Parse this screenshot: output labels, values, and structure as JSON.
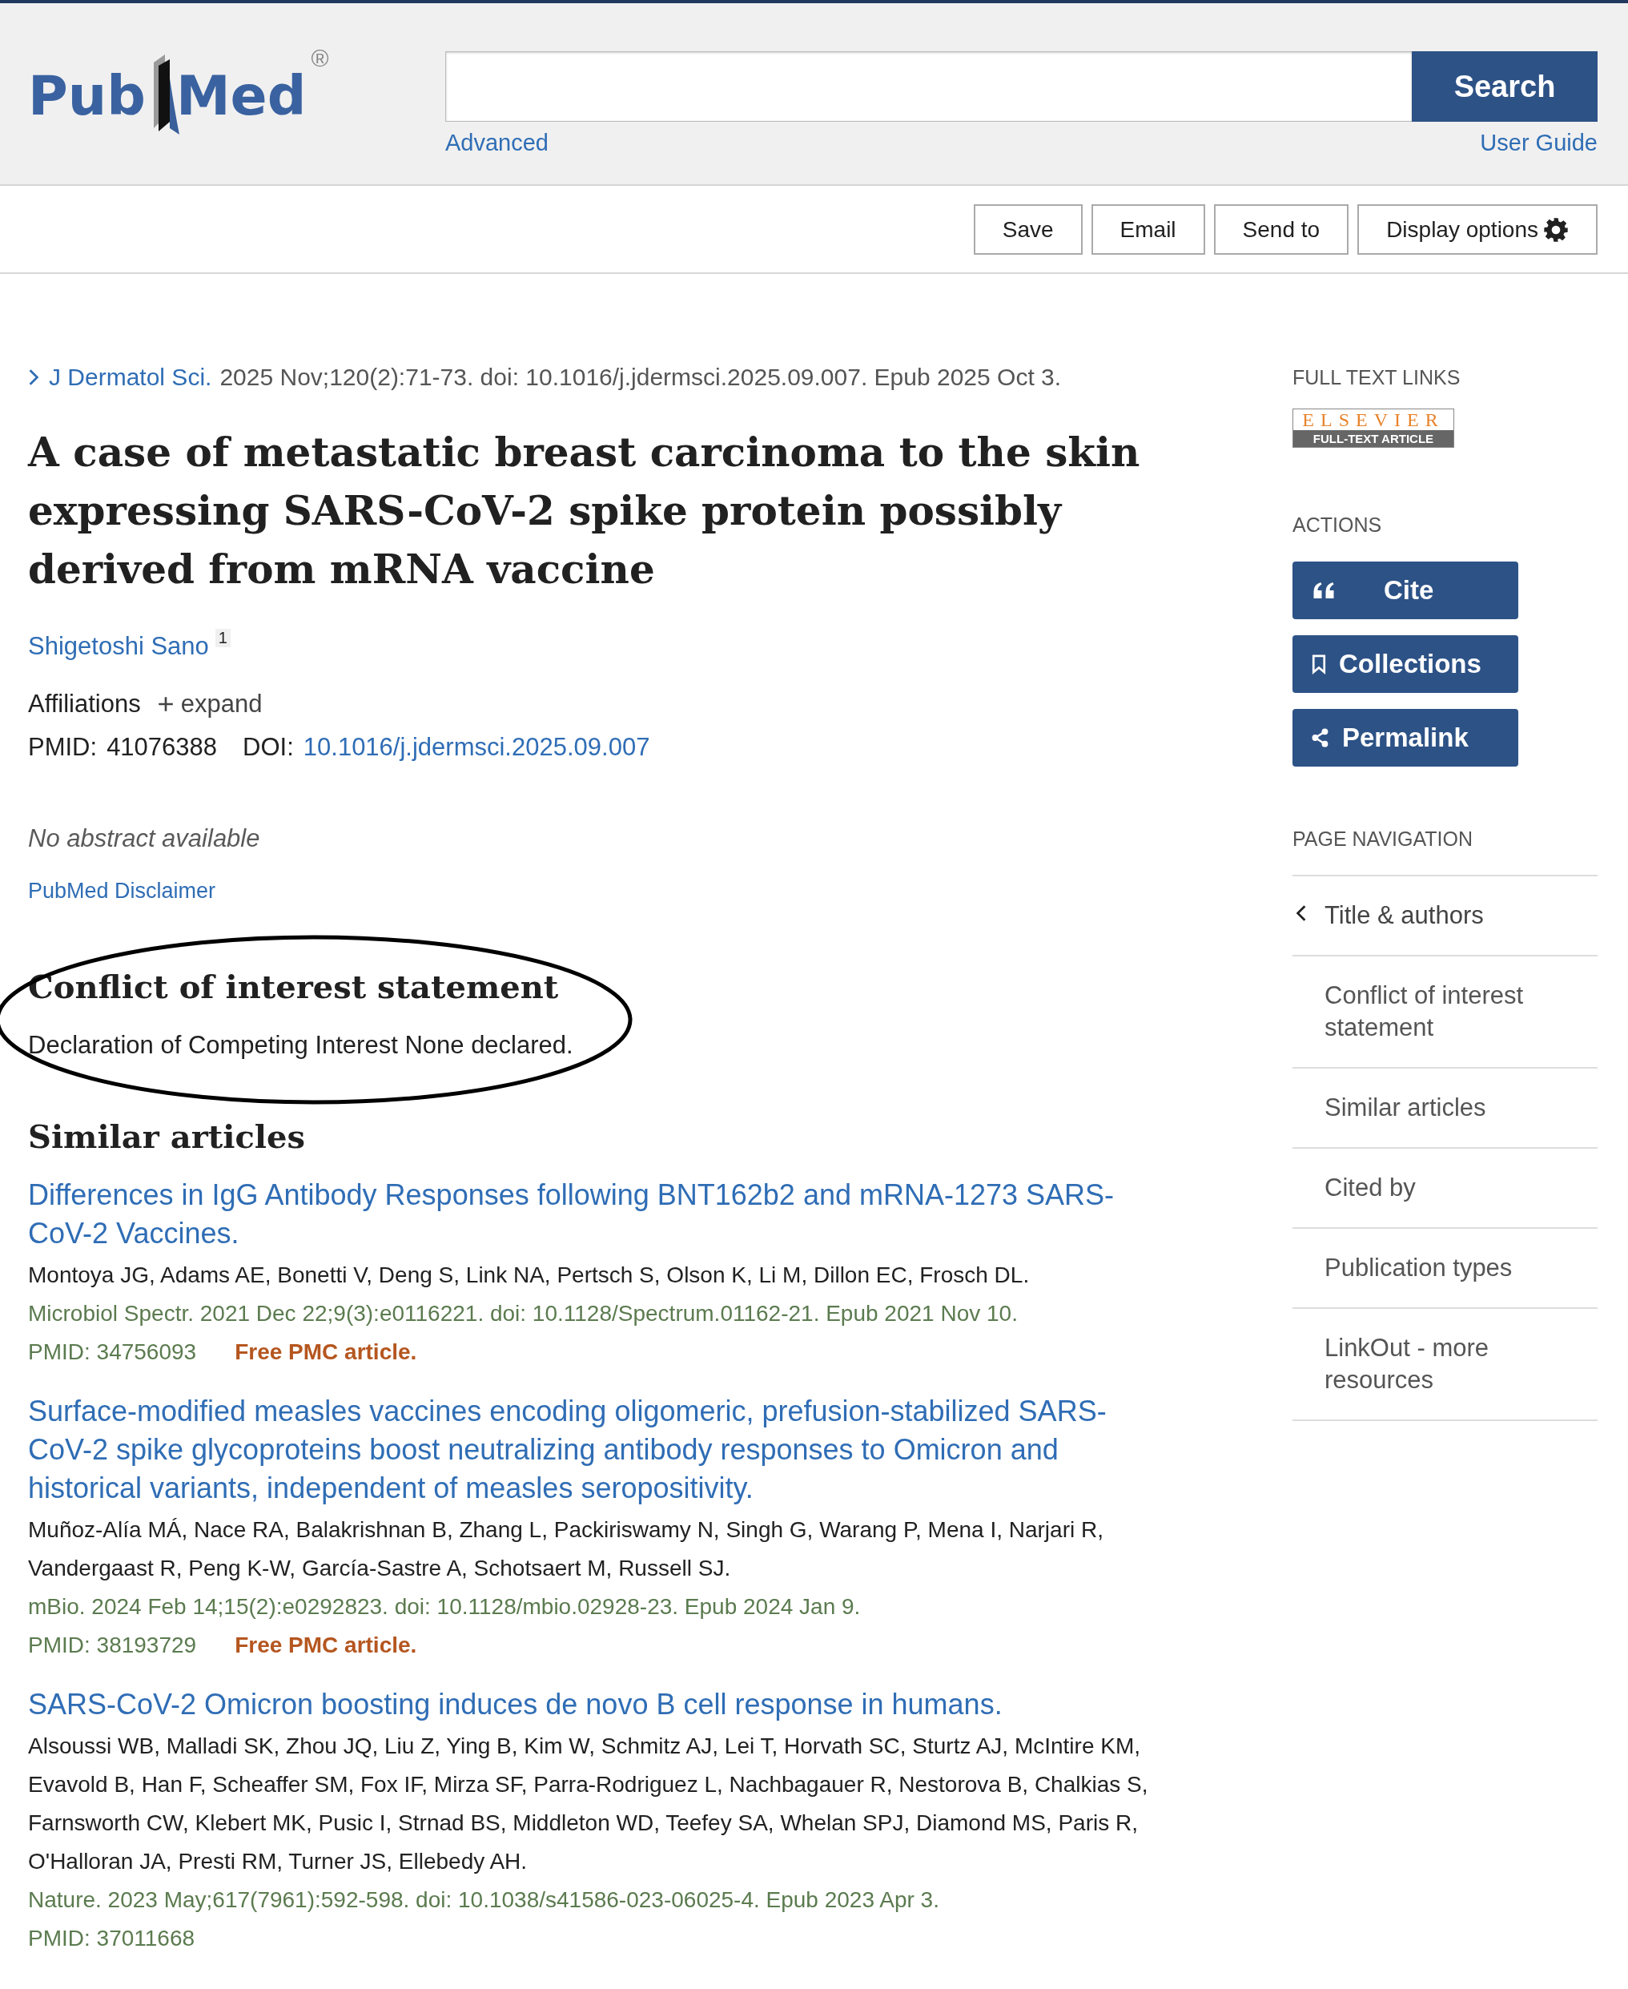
{
  "header": {
    "logo": {
      "parts": [
        "Pub",
        "Med"
      ],
      "registered": "®"
    },
    "search": {
      "button": "Search",
      "advanced": "Advanced",
      "guide": "User Guide"
    }
  },
  "toolbar": [
    {
      "label": "Save",
      "kind": "plain"
    },
    {
      "label": "Email",
      "kind": "plain"
    },
    {
      "label": "Send to",
      "kind": "plain"
    },
    {
      "label": "Display options",
      "kind": "options"
    }
  ],
  "article": {
    "journal": "J Dermatol Sci.",
    "citation": "2025 Nov;120(2):71-73. doi: 10.1016/j.jdermsci.2025.09.007. Epub 2025 Oct 3.",
    "title": "A case of metastatic breast carcinoma to the skin expressing SARS-CoV-2 spike protein possibly derived from mRNA vaccine",
    "authors": [
      {
        "name": "Shigetoshi Sano",
        "affiliation": "1"
      }
    ],
    "affiliations": {
      "label": "Affiliations",
      "toggle": "expand",
      "expanded": false
    },
    "pmid_label": "PMID:",
    "pmid": "41076388",
    "doi_label": "DOI:",
    "doi": "10.1016/j.jdermsci.2025.09.007",
    "abstract": "No abstract available",
    "disclaimer": "PubMed Disclaimer"
  },
  "conflict": {
    "heading": "Conflict of interest statement",
    "text": "Declaration of Competing Interest None declared."
  },
  "similar": {
    "heading": "Similar articles",
    "items": [
      {
        "title": "Differences in IgG Antibody Responses following BNT162b2 and mRNA-1273 SARS-CoV-2 Vaccines.",
        "authors": "Montoya JG, Adams AE, Bonetti V, Deng S, Link NA, Pertsch S, Olson K, Li M, Dillon EC, Frosch DL.",
        "citation": "Microbiol Spectr. 2021 Dec 22;9(3):e0116221. doi: 10.1128/Spectrum.01162-21. Epub 2021 Nov 10.",
        "pmid": "PMID: 34756093",
        "free": "Free PMC article."
      },
      {
        "title": "Surface-modified measles vaccines encoding oligomeric, prefusion-stabilized SARS-CoV-2 spike glycoproteins boost neutralizing antibody responses to Omicron and historical variants, independent of measles seropositivity.",
        "authors": "Muñoz-Alía MÁ, Nace RA, Balakrishnan B, Zhang L, Packiriswamy N, Singh G, Warang P, Mena I, Narjari R, Vandergaast R, Peng K-W, García-Sastre A, Schotsaert M, Russell SJ.",
        "citation": "mBio. 2024 Feb 14;15(2):e0292823. doi: 10.1128/mbio.02928-23. Epub 2024 Jan 9.",
        "pmid": "PMID: 38193729",
        "free": "Free PMC article."
      },
      {
        "title": "SARS-CoV-2 Omicron boosting induces de novo B cell response in humans.",
        "authors": "Alsoussi WB, Malladi SK, Zhou JQ, Liu Z, Ying B, Kim W, Schmitz AJ, Lei T, Horvath SC, Sturtz AJ, McIntire KM, Evavold B, Han F, Scheaffer SM, Fox IF, Mirza SF, Parra-Rodriguez L, Nachbagauer R, Nestorova B, Chalkias S, Farnsworth CW, Klebert MK, Pusic I, Strnad BS, Middleton WD, Teefey SA, Whelan SPJ, Diamond MS, Paris R, O'Halloran JA, Presti RM, Turner JS, Ellebedy AH.",
        "citation": "Nature. 2023 May;617(7961):592-598. doi: 10.1038/s41586-023-06025-4. Epub 2023 Apr 3.",
        "pmid": "PMID: 37011668"
      }
    ]
  },
  "sidebar": {
    "full_text_heading": "FULL TEXT LINKS",
    "badge": {
      "top": "ELSEVIER",
      "bottom": "FULL-TEXT ARTICLE"
    },
    "actions_heading": "ACTIONS",
    "actions": [
      {
        "label": "Cite",
        "kind": "cite"
      },
      {
        "label": "Collections",
        "kind": "collections"
      },
      {
        "label": "Permalink",
        "kind": "permalink"
      }
    ],
    "nav_heading": "PAGE NAVIGATION",
    "nav": [
      {
        "label": "Title & authors",
        "selected": true
      },
      {
        "label": "Conflict of interest statement",
        "selected": false
      },
      {
        "label": "Similar articles",
        "selected": false
      },
      {
        "label": "Cited by",
        "selected": false
      },
      {
        "label": "Publication types",
        "selected": false
      },
      {
        "label": "LinkOut - more resources",
        "selected": false
      }
    ]
  }
}
